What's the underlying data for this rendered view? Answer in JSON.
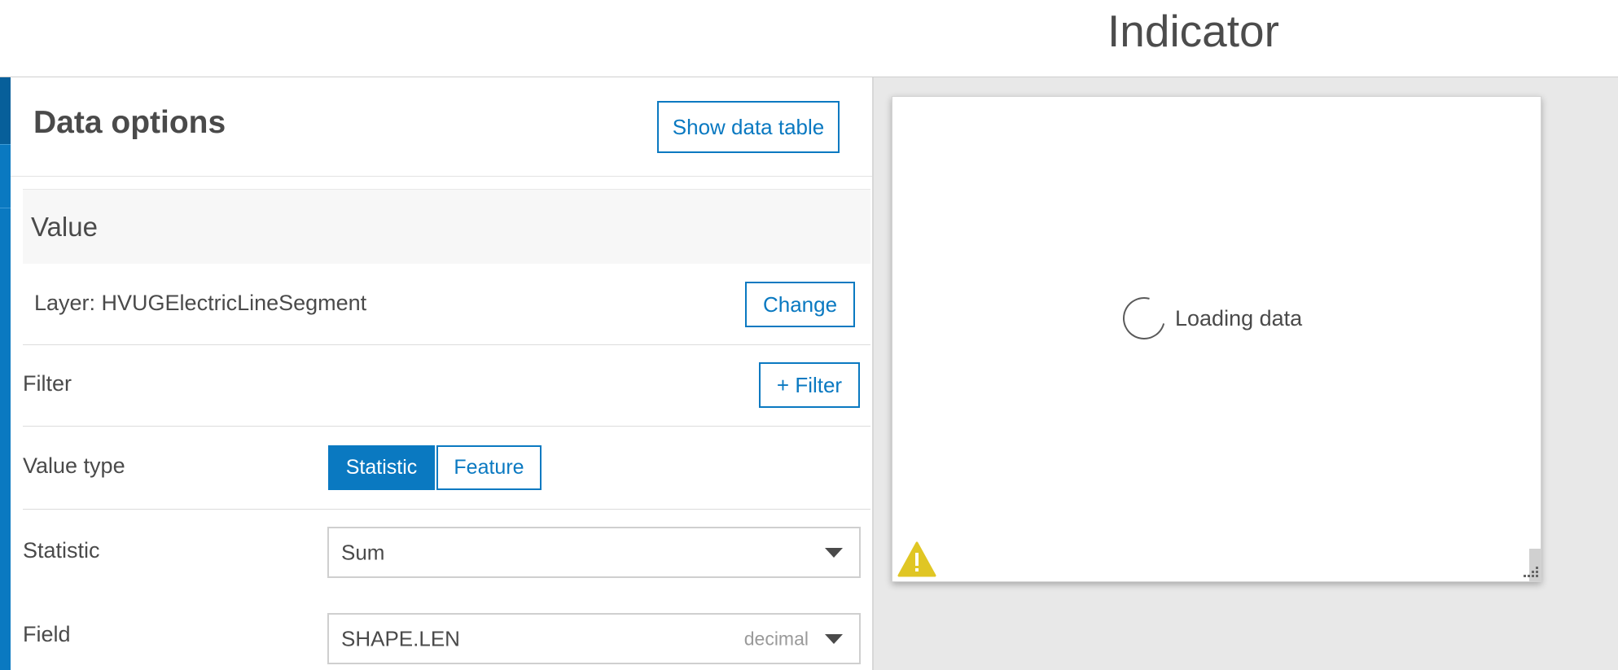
{
  "header": {
    "title": "Indicator"
  },
  "panel": {
    "title": "Data options",
    "show_table_label": "Show data table",
    "section_title": "Value",
    "layer_label": "Layer: HVUGElectricLineSegment",
    "change_label": "Change",
    "filter_label": "Filter",
    "add_filter_label": "+ Filter",
    "value_type_label": "Value type",
    "value_type_options": [
      "Statistic",
      "Feature"
    ],
    "value_type_selected": "Statistic",
    "statistic_label": "Statistic",
    "statistic_value": "Sum",
    "field_label": "Field",
    "field_value": "SHAPE.LEN",
    "field_type": "decimal"
  },
  "preview": {
    "loading_text": "Loading data",
    "warning_icon": "warning-icon",
    "resize_icon": "resize-handle-icon"
  },
  "colors": {
    "accent": "#0a79c1",
    "warning": "#e0c624",
    "preview_bg": "#e8e8e8"
  }
}
